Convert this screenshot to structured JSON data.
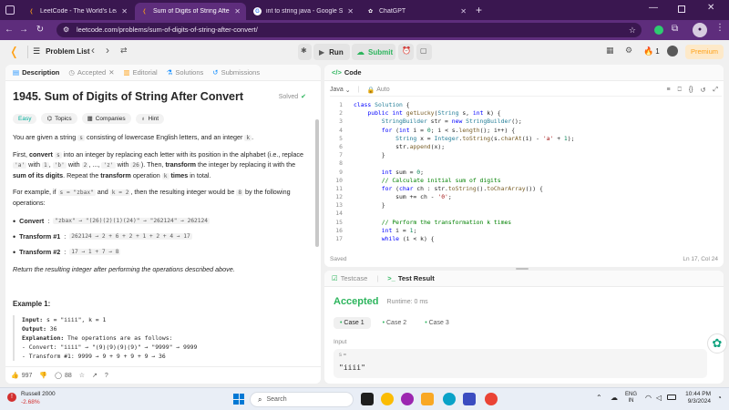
{
  "browser": {
    "tabs": [
      {
        "title": "LeetCode - The World's Leadi",
        "active": false
      },
      {
        "title": "Sum of Digits of String After C",
        "active": true
      },
      {
        "title": "int to string java - Google Sear",
        "active": false
      },
      {
        "title": "ChatGPT",
        "active": false
      }
    ],
    "url": "leetcode.com/problems/sum-of-digits-of-string-after-convert/"
  },
  "nav": {
    "problem_list": "Problem List",
    "run": "Run",
    "submit": "Submit",
    "streak": "1",
    "premium": "Premium"
  },
  "desc_tabs": [
    "Description",
    "Accepted",
    "Editorial",
    "Solutions",
    "Submissions"
  ],
  "problem": {
    "title": "1945. Sum of Digits of String After Convert",
    "solved": "Solved",
    "tags": [
      "Easy",
      "Topics",
      "Companies",
      "Hint"
    ],
    "p1_a": "You are given a string ",
    "p1_s": "s",
    "p1_b": " consisting of lowercase English letters, and an integer ",
    "p1_k": "k",
    "p1_c": ".",
    "p2_a": "First, ",
    "p2_convert": "convert",
    "p2_s": "s",
    "p2_b": " into an integer by replacing each letter with its position in the alphabet (i.e., replace ",
    "p2_a_code": "'a'",
    "p2_c": " with ",
    "p2_1": "1",
    "p2_d": ", ",
    "p2_b_code": "'b'",
    "p2_e": " with ",
    "p2_2": "2",
    "p2_f": ", ..., ",
    "p2_z": "'z'",
    "p2_g": " with ",
    "p2_26": "26",
    "p2_h": "). Then, ",
    "p2_transform": "transform",
    "p2_i": " the integer by replacing it with the ",
    "p2_sum": "sum of its digits",
    "p2_j": ". Repeat the ",
    "p2_transform2": "transform",
    "p2_k": " operation ",
    "p2_kc": "k",
    "p2_times": " times",
    "p2_l": " in total.",
    "p3_a": "For example, if ",
    "p3_s": "s = \"zbax\"",
    "p3_b": " and ",
    "p3_k": "k = 2",
    "p3_c": ", then the resulting integer would be ",
    "p3_8": "8",
    "p3_d": " by the following operations:",
    "bullets": [
      {
        "label": "Convert",
        "text": "\"zbax\" → \"(26)(2)(1)(24)\" → \"262124\" → 262124"
      },
      {
        "label": "Transform #1",
        "text": "262124 → 2 + 6 + 2 + 1 + 2 + 4 → 17"
      },
      {
        "label": "Transform #2",
        "text": "17 → 1 + 7 → 8"
      }
    ],
    "return_text": "Return the resulting integer after performing the operations described above.",
    "example_title": "Example 1:",
    "example_lines": [
      {
        "label": "Input:",
        "text": " s = \"iiii\", k = 1"
      },
      {
        "label": "Output:",
        "text": " 36"
      },
      {
        "label": "Explanation:",
        "text": " The operations are as follows:"
      },
      {
        "label": "",
        "text": "- Convert: \"iiii\" → \"(9)(9)(9)(9)\" → \"9999\" → 9999"
      },
      {
        "label": "",
        "text": "- Transform #1: 9999 → 9 + 9 + 9 + 9 → 36"
      }
    ],
    "likes": "997",
    "comments": "88"
  },
  "code_panel": {
    "title": "Code",
    "language": "Java",
    "auto": "Auto",
    "saved": "Saved",
    "cursor": "Ln 17, Col 24"
  },
  "code_lines": [
    "class Solution {",
    "    public int getLucky(String s, int k) {",
    "        StringBuilder str = new StringBuilder();",
    "        for (int i = 0; i < s.length(); i++) {",
    "            String x = Integer.toString(s.charAt(i) - 'a' + 1);",
    "            str.append(x);",
    "        }",
    "",
    "        int sum = 0;",
    "        // Calculate initial sum of digits",
    "        for (char ch : str.toString().toCharArray()) {",
    "            sum += ch - '0';",
    "        }",
    "",
    "        // Perform the transformation k times",
    "        int i = 1;",
    "        while (i < k) {"
  ],
  "result_panel": {
    "testcase": "Testcase",
    "test_result": "Test Result",
    "accepted": "Accepted",
    "runtime": "Runtime: 0 ms",
    "cases": [
      "Case 1",
      "Case 2",
      "Case 3"
    ],
    "input_label": "Input",
    "input_var": "s =",
    "input_value": "\"iiii\""
  },
  "taskbar": {
    "stock_name": "Russell 2000",
    "stock_change": "-2.68%",
    "search": "Search",
    "lang1": "ENG",
    "lang2": "IN",
    "time": "10:44 PM",
    "date": "9/3/2024"
  }
}
